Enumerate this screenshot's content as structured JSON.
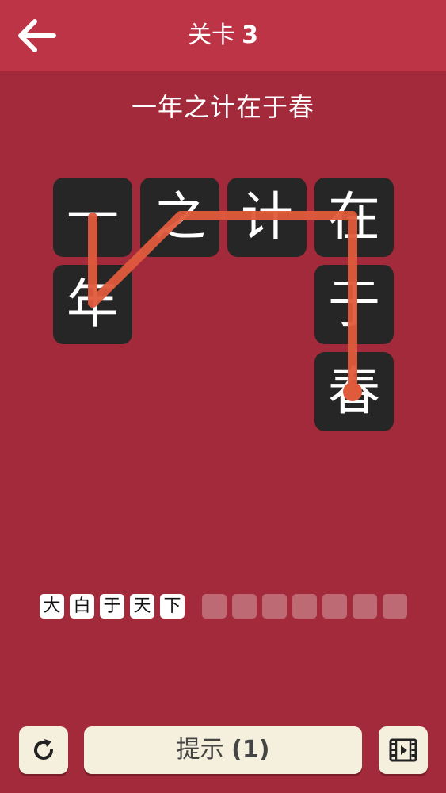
{
  "header": {
    "level_prefix": "关卡",
    "level_number": "3"
  },
  "target_idiom": "一年之计在于春",
  "board": {
    "tiles": [
      "一",
      "年",
      "之",
      "计",
      "在",
      "于",
      "春"
    ]
  },
  "collected": {
    "chars": [
      "大",
      "白",
      "于",
      "天",
      "下"
    ],
    "empty_slots": 7
  },
  "footer": {
    "hint_label": "提示",
    "hint_count": "(1)"
  },
  "icons": {
    "back": "arrow-left-icon",
    "reset": "refresh-icon",
    "video": "film-icon"
  },
  "colors": {
    "background": "#a22a3a",
    "header": "#bd3446",
    "tile": "#262626",
    "path": "#e05a3c",
    "button": "#f4f0dd"
  }
}
